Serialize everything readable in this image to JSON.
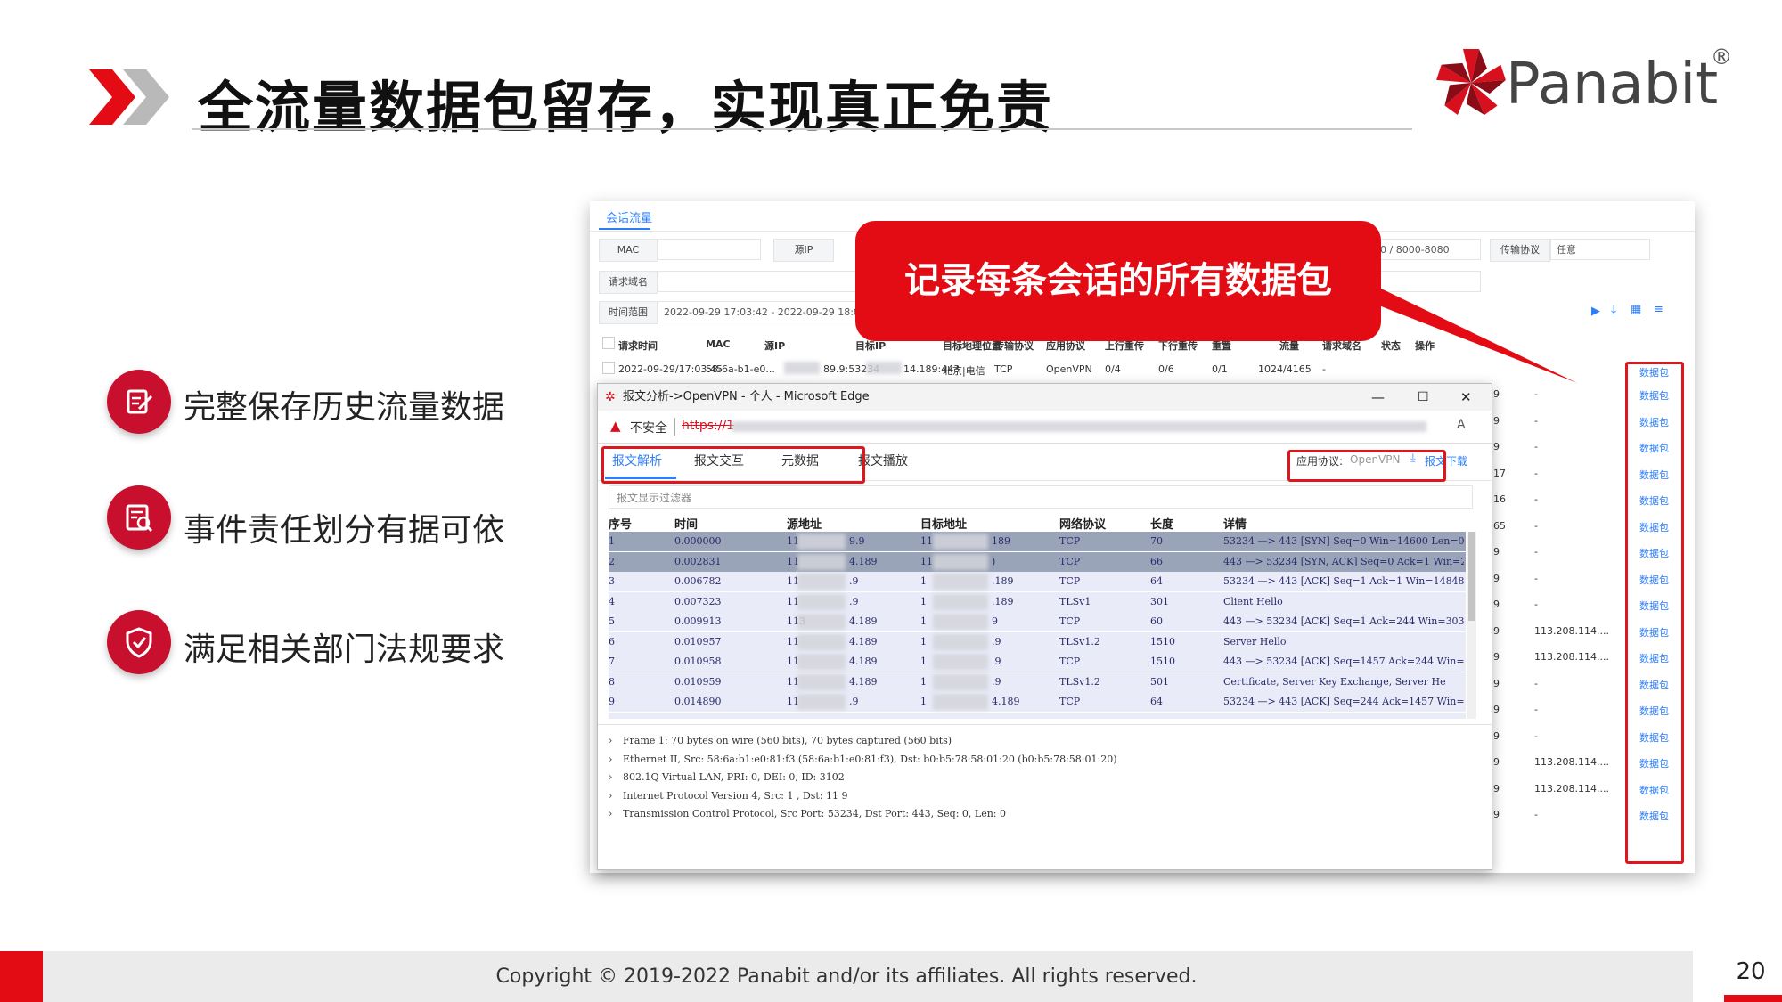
{
  "slide": {
    "title": "全流量数据包留存，实现真正免责",
    "logo": {
      "text": "Panabit",
      "reg": "®"
    },
    "features": [
      {
        "icon": "edit-document-icon",
        "text": "完整保存历史流量数据"
      },
      {
        "icon": "audit-list-icon",
        "text": "事件责任划分有据可依"
      },
      {
        "icon": "shield-check-icon",
        "text": "满足相关部门法规要求"
      }
    ],
    "callout": "记录每条会话的所有数据包",
    "footer": "Copyright © 2019-2022 Panabit and/or its affiliates. All rights reserved.",
    "page_number": "20",
    "colors": {
      "brand_red": "#e30b14",
      "link_blue": "#2d7ef7",
      "row_selected": "#9aa4b8",
      "row_normal": "#e9ebf8"
    }
  },
  "session_panel": {
    "tab": "会话流量",
    "filters": {
      "mac_label": "MAC",
      "src_ip_label": "源IP",
      "port_value": "0 / 8000-8080",
      "protocol_label": "传输协议",
      "protocol_value": "任意",
      "domain_label": "请求域名",
      "time_label": "时间范围",
      "time_value": "2022-09-29 17:03:42 - 2022-09-29 18:03"
    },
    "headers": [
      "请求时间",
      "MAC",
      "源IP",
      "目标IP",
      "目标地理位置",
      "传输协议",
      "应用协议",
      "上行重传",
      "下行重传",
      "重置",
      "流量",
      "请求域名",
      "状态",
      "操作"
    ],
    "first_row": [
      "2022-09-29/17:03:45",
      "58-6a-b1-e0...",
      "89.9:53234",
      "14.189:443",
      "北京|电信",
      "TCP",
      "OpenVPN",
      "0/4",
      "0/6",
      "0/1",
      "1024/4165",
      "-"
    ],
    "right_rows": [
      {
        "n": "9",
        "domain": "-"
      },
      {
        "n": "9",
        "domain": "-"
      },
      {
        "n": "9",
        "domain": "-"
      },
      {
        "n": "17",
        "domain": "-"
      },
      {
        "n": "16",
        "domain": "-"
      },
      {
        "n": "65",
        "domain": "-"
      },
      {
        "n": "9",
        "domain": "-"
      },
      {
        "n": "9",
        "domain": "-"
      },
      {
        "n": "9",
        "domain": "-"
      },
      {
        "n": "9",
        "domain": "113.208.114...."
      },
      {
        "n": "9",
        "domain": "113.208.114...."
      },
      {
        "n": "9",
        "domain": "-"
      },
      {
        "n": "9",
        "domain": "-"
      },
      {
        "n": "9",
        "domain": "-"
      },
      {
        "n": "9",
        "domain": "113.208.114...."
      },
      {
        "n": "9",
        "domain": "113.208.114...."
      },
      {
        "n": "9",
        "domain": "-"
      }
    ],
    "action_link": "数据包"
  },
  "packet_window": {
    "title": "报文分析->OpenVPN - 个人 - Microsoft Edge",
    "addr_warning": "不安全",
    "addr_scheme": "https://1",
    "tabs": [
      "报文解析",
      "报文交互",
      "元数据",
      "报文播放"
    ],
    "app_protocol_label": "应用协议:",
    "app_protocol_value": "OpenVPN",
    "download": "报文下载",
    "filter_placeholder": "报文显示过滤器",
    "headers": [
      "序号",
      "时间",
      "源地址",
      "目标地址",
      "网络协议",
      "长度",
      "详情"
    ],
    "rows": [
      {
        "no": "1",
        "time": "0.000000",
        "src": "11",
        "src2": "9.9",
        "dst": "11",
        "dst2": "189",
        "proto": "TCP",
        "len": "70",
        "info": "53234 —> 443 [SYN] Seq=0 Win=14600 Len=0 I"
      },
      {
        "no": "2",
        "time": "0.002831",
        "src": "11",
        "src2": "4.189",
        "dst": "11",
        "dst2": ")",
        "proto": "TCP",
        "len": "66",
        "info": "443 —> 53234 [SYN, ACK] Seq=0 Ack=1 Win=29"
      },
      {
        "no": "3",
        "time": "0.006782",
        "src": "11",
        "src2": ".9",
        "dst": "1",
        "dst2": ".189",
        "proto": "TCP",
        "len": "64",
        "info": "53234 —> 443 [ACK] Seq=1 Ack=1 Win=14848 I"
      },
      {
        "no": "4",
        "time": "0.007323",
        "src": "11",
        "src2": ".9",
        "dst": "1",
        "dst2": ".189",
        "proto": "TLSv1",
        "len": "301",
        "info": "Client Hello"
      },
      {
        "no": "5",
        "time": "0.009913",
        "src": "113",
        "src2": "4.189",
        "dst": "1",
        "dst2": "9",
        "proto": "TCP",
        "len": "60",
        "info": "443 —> 53234 [ACK] Seq=1 Ack=244 Win=3033"
      },
      {
        "no": "6",
        "time": "0.010957",
        "src": "11",
        "src2": "4.189",
        "dst": "1",
        "dst2": ".9",
        "proto": "TLSv1.2",
        "len": "1510",
        "info": "Server Hello"
      },
      {
        "no": "7",
        "time": "0.010958",
        "src": "11",
        "src2": "4.189",
        "dst": "1",
        "dst2": ".9",
        "proto": "TCP",
        "len": "1510",
        "info": "443 —> 53234 [ACK] Seq=1457 Ack=244 Win=3"
      },
      {
        "no": "8",
        "time": "0.010959",
        "src": "11",
        "src2": "4.189",
        "dst": "1",
        "dst2": ".9",
        "proto": "TLSv1.2",
        "len": "501",
        "info": "Certificate, Server Key Exchange, Server He"
      },
      {
        "no": "9",
        "time": "0.014890",
        "src": "11",
        "src2": ".9",
        "dst": "1",
        "dst2": "4.189",
        "proto": "TCP",
        "len": "64",
        "info": "53234 —> 443 [ACK] Seq=244 Ack=1457 Win=1"
      }
    ],
    "details": [
      "Frame 1: 70 bytes on wire (560 bits), 70 bytes captured (560 bits)",
      "Ethernet II, Src: 58:6a:b1:e0:81:f3 (58:6a:b1:e0:81:f3), Dst: b0:b5:78:58:01:20 (b0:b5:78:58:01:20)",
      "802.1Q Virtual LAN, PRI: 0, DEI: 0, ID: 3102",
      "Internet Protocol Version 4, Src: 1              , Dst: 11              9",
      "Transmission Control Protocol, Src Port: 53234, Dst Port: 443, Seq: 0, Len: 0"
    ]
  }
}
